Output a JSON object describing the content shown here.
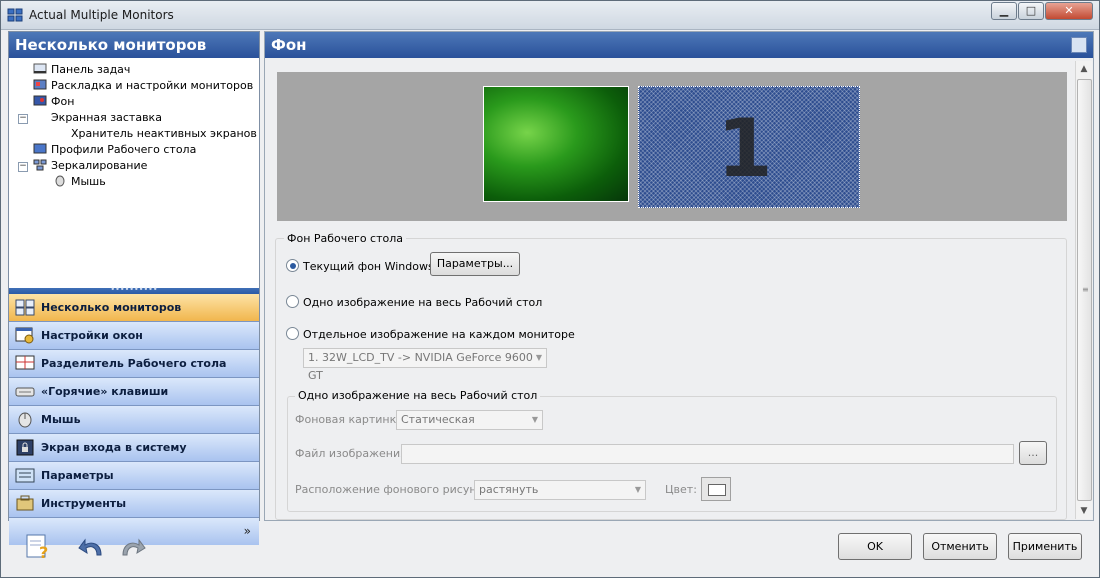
{
  "window": {
    "title": "Actual Multiple Monitors"
  },
  "left_pane": {
    "header": "Несколько мониторов",
    "tree": [
      {
        "label": "Панель задач",
        "icon": "taskbar-icon"
      },
      {
        "label": "Раскладка и настройки мониторов",
        "icon": "monitor-layout-icon"
      },
      {
        "label": "Фон",
        "icon": "wallpaper-icon"
      },
      {
        "label": "Экранная заставка",
        "icon": "none"
      },
      {
        "label": "Хранитель неактивных экранов",
        "icon": "none"
      },
      {
        "label": "Профили Рабочего стола",
        "icon": "desktop-profile-icon"
      },
      {
        "label": "Зеркалирование",
        "icon": "mirror-icon"
      },
      {
        "label": "Мышь",
        "icon": "mouse-icon"
      }
    ],
    "nav": [
      {
        "label": "Несколько мониторов",
        "icon": "multi-monitor-icon",
        "active": true
      },
      {
        "label": "Настройки окон",
        "icon": "window-settings-icon"
      },
      {
        "label": "Разделитель Рабочего стола",
        "icon": "desktop-divider-icon"
      },
      {
        "label": "«Горячие» клавиши",
        "icon": "keyboard-icon"
      },
      {
        "label": "Мышь",
        "icon": "mouse-icon"
      },
      {
        "label": "Экран входа в систему",
        "icon": "lock-icon"
      },
      {
        "label": "Параметры",
        "icon": "options-icon"
      },
      {
        "label": "Инструменты",
        "icon": "tools-icon"
      }
    ],
    "more_glyph": "»"
  },
  "right_pane": {
    "header": "Фон",
    "monitor_number": "1",
    "desktop_bg_group": {
      "legend": "Фон Рабочего стола",
      "option_windows": "Текущий фон Windows",
      "params_button": "Параметры...",
      "option_single": "Одно изображение на весь Рабочий стол",
      "option_each": "Отдельное изображение на каждом мониторе",
      "monitor_select": "1. 32W_LCD_TV -> NVIDIA GeForce 9600 GT",
      "selected_option": "windows"
    },
    "single_image_group": {
      "legend": "Одно изображение на весь Рабочий стол",
      "bg_picture_label": "Фоновая картинка",
      "bg_picture_value": "Статическая",
      "image_file_label": "Файл изображения:",
      "image_file_value": "",
      "browse_button": "...",
      "position_label": "Расположение фонового рисунка:",
      "position_value": "растянуть",
      "color_label": "Цвет:"
    }
  },
  "footer": {
    "ok": "OK",
    "cancel": "Отменить",
    "apply": "Применить"
  },
  "colors": {
    "header_blue": "#2a519a",
    "nav_active": "#f1b64d",
    "nav_inactive": "#a9c3ef"
  }
}
